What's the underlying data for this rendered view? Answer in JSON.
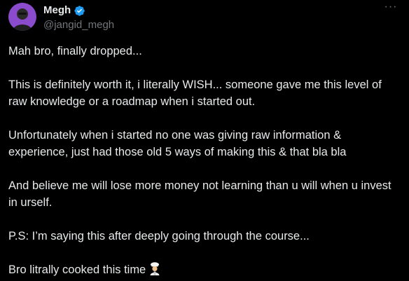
{
  "author": {
    "name": "Megh",
    "handle": "@jangid_megh",
    "verified": true,
    "avatar_icon": "avatar-icon"
  },
  "menu_icon": "more-dots-icon",
  "menu_glyph": "···",
  "colors": {
    "background": "#000000",
    "text": "#e7e9ea",
    "muted": "#71767b",
    "verified_blue": "#1d9bf0"
  },
  "post": {
    "paragraphs": [
      "Mah bro, finally dropped...",
      "This is definitely worth it, i literally WISH... someone gave me this level of raw knowledge or a roadmap when i started out.",
      "Unfortunately when i started no one was giving raw information & experience, just had those old 5 ways of making this & that bla bla",
      "And believe me will lose more money not learning than u will when u invest in urself.",
      "P.S: I’m saying this after deeply going through the course...",
      "Bro litrally cooked this time"
    ],
    "trailing_emoji_icon": "chef-emoji-icon"
  }
}
